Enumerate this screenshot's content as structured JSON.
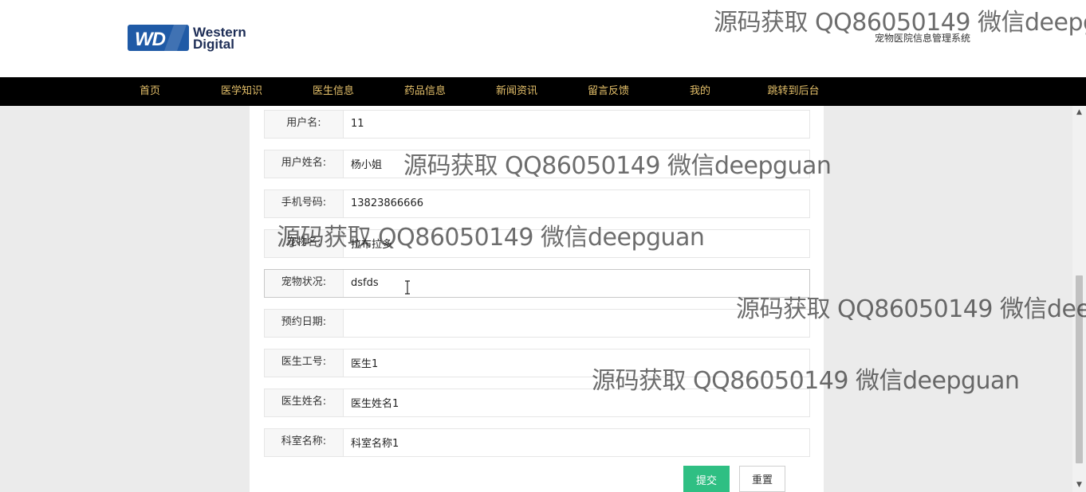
{
  "header": {
    "logo_text_line1": "Western",
    "logo_text_line2": "Digital",
    "logo_badge": "WD",
    "site_title": "宠物医院信息管理系统"
  },
  "nav": {
    "items": [
      "首页",
      "医学知识",
      "医生信息",
      "药品信息",
      "新闻资讯",
      "留言反馈",
      "我的",
      "跳转到后台"
    ]
  },
  "form": {
    "fields": [
      {
        "label": "用户名:",
        "value": "11"
      },
      {
        "label": "用户姓名:",
        "value": "杨小姐"
      },
      {
        "label": "手机号码:",
        "value": "13823866666"
      },
      {
        "label": "宠物名:",
        "value": "拉布拉多"
      },
      {
        "label": "宠物状况:",
        "value": "dsfds"
      },
      {
        "label": "预约日期:",
        "value": ""
      },
      {
        "label": "医生工号:",
        "value": "医生1"
      },
      {
        "label": "医生姓名:",
        "value": "医生姓名1"
      },
      {
        "label": "科室名称:",
        "value": "科室名称1"
      }
    ],
    "submit_label": "提交",
    "reset_label": "重置"
  },
  "watermark": {
    "text": "源码获取 QQ86050149 微信deepguan"
  },
  "colors": {
    "nav_bg": "#000000",
    "nav_text": "#e5c06a",
    "submit_bg": "#2fbf83",
    "content_bg": "#ebebeb"
  }
}
